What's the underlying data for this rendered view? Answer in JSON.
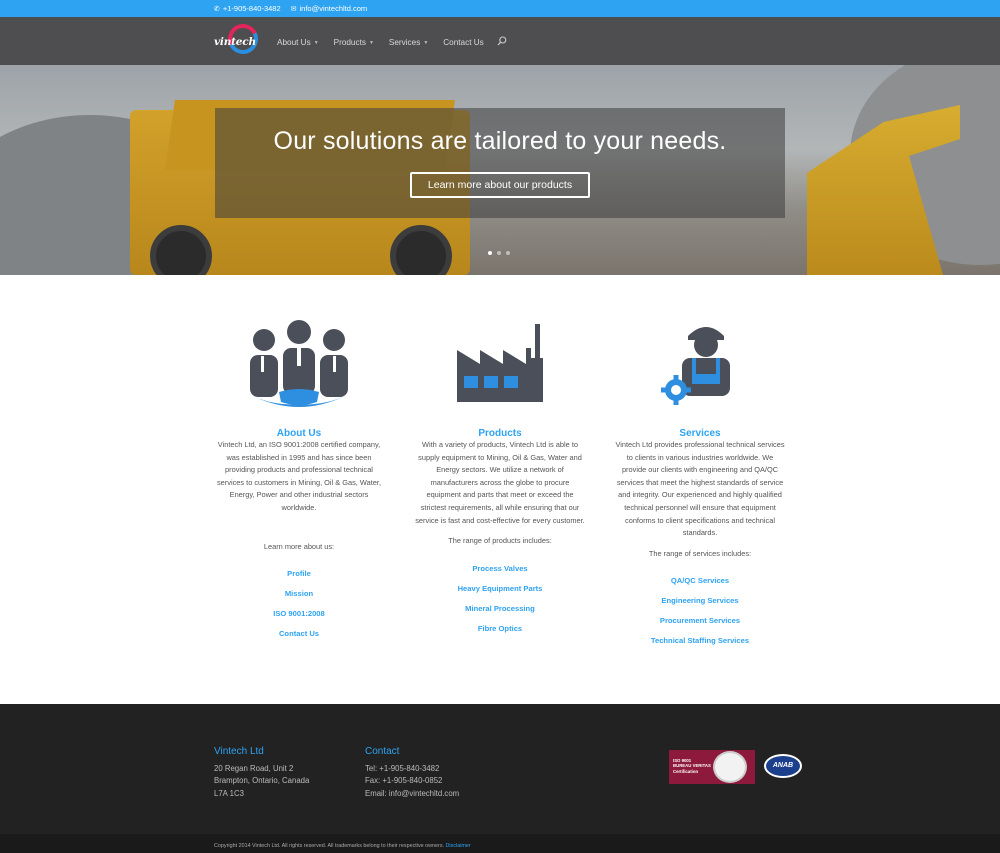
{
  "topbar": {
    "phone": "+1-905-840-3482",
    "email": "info@vintechltd.com",
    "phone_icon": "phone-icon",
    "email_icon": "envelope-icon"
  },
  "header": {
    "logo_text": "vintech",
    "nav": [
      {
        "label": "About Us",
        "has_dropdown": true
      },
      {
        "label": "Products",
        "has_dropdown": true
      },
      {
        "label": "Services",
        "has_dropdown": true
      },
      {
        "label": "Contact Us",
        "has_dropdown": false
      }
    ],
    "search_icon": "search-icon"
  },
  "hero": {
    "headline": "Our solutions are tailored to your needs.",
    "cta_label": "Learn more about our products",
    "slides": 3,
    "active_slide": 1
  },
  "columns": {
    "about": {
      "icon": "people-group-icon",
      "title": "About Us",
      "body": "Vintech Ltd, an ISO 9001:2008 certified company, was established in 1995 and has since been providing products and professional technical services to customers in Mining, Oil & Gas, Water, Energy, Power and other industrial sectors worldwide.",
      "learn": "Learn more about us:",
      "links": [
        "Profile",
        "Mission",
        "ISO 9001:2008",
        "Contact Us"
      ]
    },
    "products": {
      "icon": "factory-icon",
      "title": "Products",
      "body": "With a variety of products, Vintech Ltd is able to supply equipment to Mining, Oil & Gas, Water and Energy sectors. We utilize a network of manufacturers across the globe to procure equipment and parts that meet or exceed the strictest requirements, all while ensuring that our service is fast and cost-effective for every customer.",
      "range": "The range of products includes:",
      "links": [
        "Process Valves",
        "Heavy Equipment Parts",
        "Mineral Processing",
        "Fibre Optics"
      ]
    },
    "services": {
      "icon": "engineer-gear-icon",
      "title": "Services",
      "body": "Vintech Ltd provides professional technical services to clients in various industries worldwide. We provide our clients with engineering and QA/QC services that meet the highest standards of service and integrity. Our experienced and highly qualified technical personnel will ensure that equipment conforms to client specifications and technical standards.",
      "range": "The range of services includes:",
      "links": [
        "QA/QC Services",
        "Engineering Services",
        "Procurement Services",
        "Technical Staffing Services"
      ]
    }
  },
  "footer": {
    "company": {
      "title": "Vintech Ltd",
      "line1": "20 Regan Road, Unit 2",
      "line2": "Brampton, Ontario, Canada",
      "line3": "L7A 1C3"
    },
    "contact": {
      "title": "Contact",
      "tel": "Tel: +1-905-840-3482",
      "fax": "Fax: +1-905-840-0852",
      "email": "Email: info@vintechltd.com"
    },
    "badge1": {
      "line1": "ISO 9001",
      "line2": "BUREAU VERITAS",
      "line3": "Certification"
    },
    "badge2": "ANAB",
    "copyright": "Copyright 2014 Vintech Ltd. All rights reserved. All trademarks belong to their respective owners.",
    "disclaimer": "Disclaimer"
  },
  "colors": {
    "accent": "#2ea3f2",
    "header_bg": "#4e4e50",
    "footer_bg": "#222222",
    "icon_dark": "#4a4f5a",
    "icon_blue": "#2e8fe0"
  }
}
